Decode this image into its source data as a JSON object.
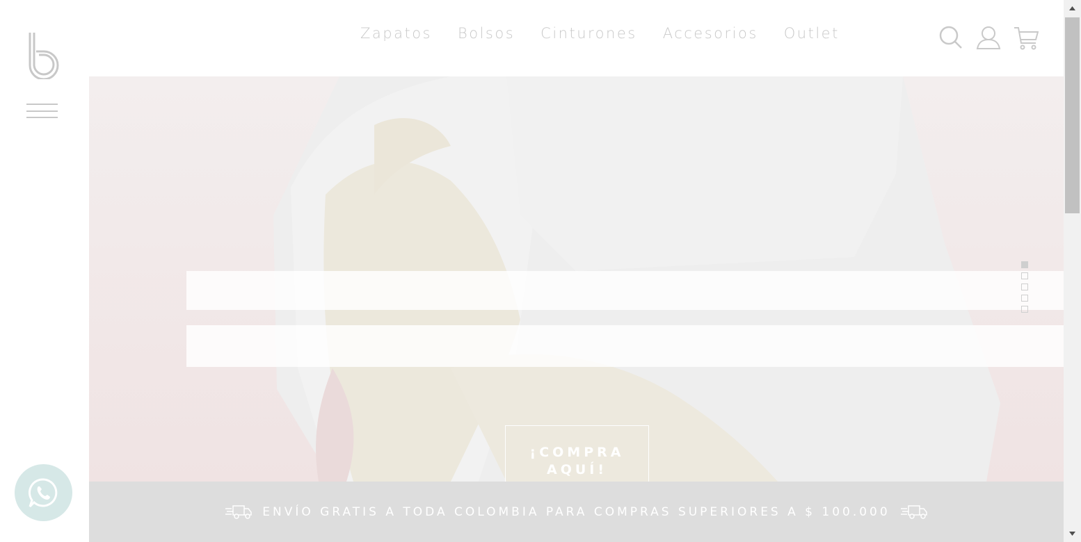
{
  "brand": {
    "logo": "b-logo-icon"
  },
  "nav": {
    "links": [
      "Zapatos",
      "Bolsos",
      "Cinturones",
      "Accesorios",
      "Outlet"
    ],
    "icons": [
      "search-icon",
      "user-icon",
      "cart-icon"
    ]
  },
  "hero": {
    "cta_label_line1": "¡COMPRA",
    "cta_label_line2": "AQUÍ!",
    "slide_count": 5,
    "active_slide": 1
  },
  "shipping": {
    "text": "ENVÍO GRATIS A TODA COLOMBIA PARA COMPRAS SUPERIORES A $ 100.000",
    "icon": "truck-icon"
  },
  "floating": {
    "icon": "whatsapp-icon"
  },
  "colors": {
    "nav_text": "#c9c9c9",
    "shipping_bg": "#dddddd",
    "whatsapp_bg": "#d6e8e7",
    "hero_bg": "#f6f1f1"
  }
}
